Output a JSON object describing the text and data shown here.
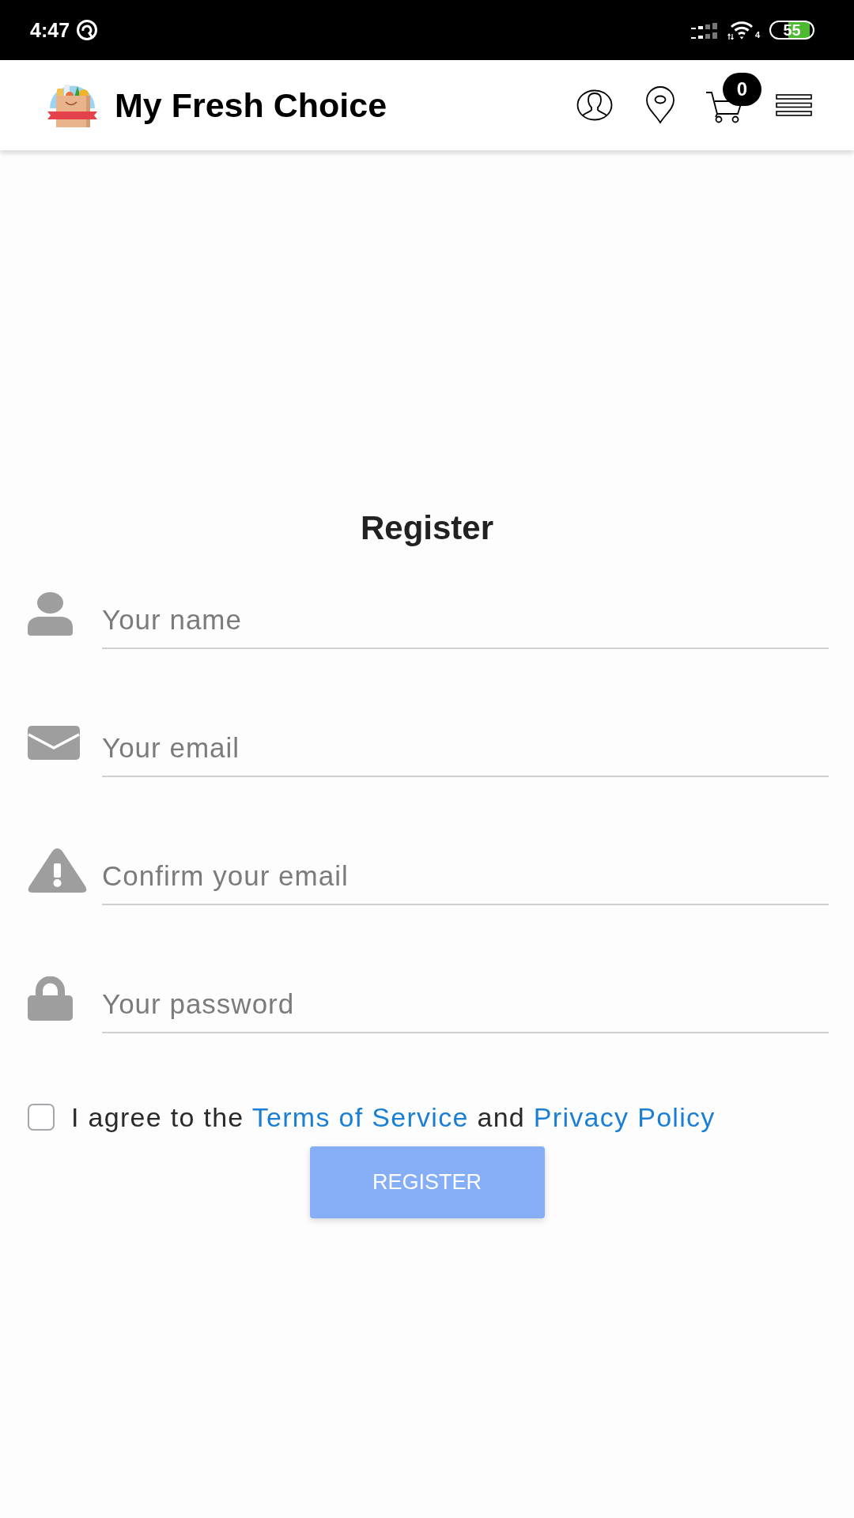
{
  "status_bar": {
    "time": "4:47",
    "network_label": "4",
    "battery": "55"
  },
  "header": {
    "title": "My Fresh Choice",
    "cart_count": "0"
  },
  "form": {
    "title": "Register",
    "fields": [
      {
        "kind": "name",
        "placeholder": "Your name"
      },
      {
        "kind": "email",
        "placeholder": "Your email"
      },
      {
        "kind": "confirm",
        "placeholder": "Confirm your email"
      },
      {
        "kind": "password",
        "placeholder": "Your password"
      }
    ],
    "agreement": {
      "checked": false,
      "parts": [
        {
          "kind": "text",
          "text": "I agree to the"
        },
        {
          "kind": "link",
          "text": "Terms of Service"
        },
        {
          "kind": "text",
          "text": "and"
        },
        {
          "kind": "link",
          "text": "Privacy Policy"
        }
      ]
    },
    "submit": {
      "label": "REGISTER",
      "disabled": true
    }
  }
}
